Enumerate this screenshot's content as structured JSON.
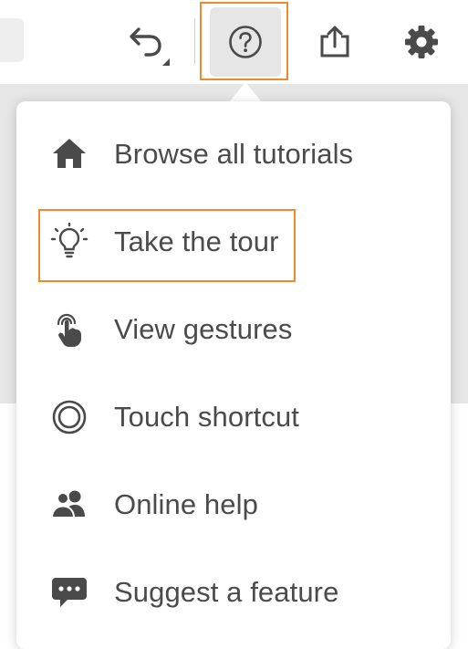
{
  "toolbar": {
    "icons": [
      "undo-icon",
      "help-icon",
      "share-icon",
      "settings-icon"
    ],
    "highlight_color": "#f08a2c"
  },
  "menu": {
    "items": [
      {
        "label": "Browse all tutorials",
        "icon": "home-icon"
      },
      {
        "label": "Take the tour",
        "icon": "lightbulb-icon"
      },
      {
        "label": "View gestures",
        "icon": "touch-gesture-icon"
      },
      {
        "label": "Touch shortcut",
        "icon": "touch-shortcut-icon"
      },
      {
        "label": "Online help",
        "icon": "people-icon"
      },
      {
        "label": "Suggest a feature",
        "icon": "speech-bubble-icon"
      }
    ],
    "highlighted_item": "Take the tour"
  }
}
